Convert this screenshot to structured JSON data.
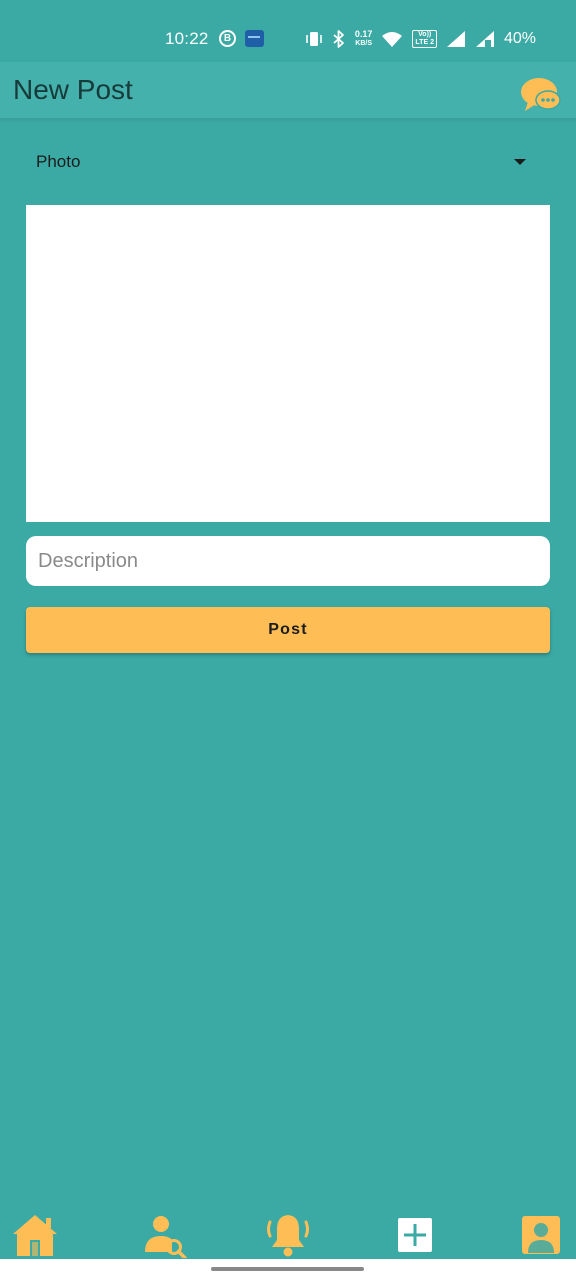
{
  "status_bar": {
    "time": "10:22",
    "b_badge": "B",
    "wallet_icon": "wallet-icon",
    "net_speed_value": "0.17",
    "net_speed_unit": "KB/S",
    "volte_line1": "Vo))",
    "volte_line2": "LTE 2",
    "battery": "40%"
  },
  "app_bar": {
    "title": "New Post",
    "chat_icon": "chat-bubble-icon"
  },
  "form": {
    "post_type_selected": "Photo",
    "description_placeholder": "Description",
    "description_value": "",
    "post_label": "Post"
  },
  "bottom_nav": {
    "items": [
      {
        "id": "home",
        "icon": "home-icon"
      },
      {
        "id": "search-user",
        "icon": "user-search-icon"
      },
      {
        "id": "notifications",
        "icon": "bell-icon"
      },
      {
        "id": "add",
        "icon": "add-icon"
      },
      {
        "id": "profile",
        "icon": "profile-icon"
      }
    ]
  },
  "colors": {
    "background": "#3BA9A4",
    "app_bar": "#44B1AC",
    "accent": "#FFBE55",
    "title_text": "#173B3A"
  }
}
